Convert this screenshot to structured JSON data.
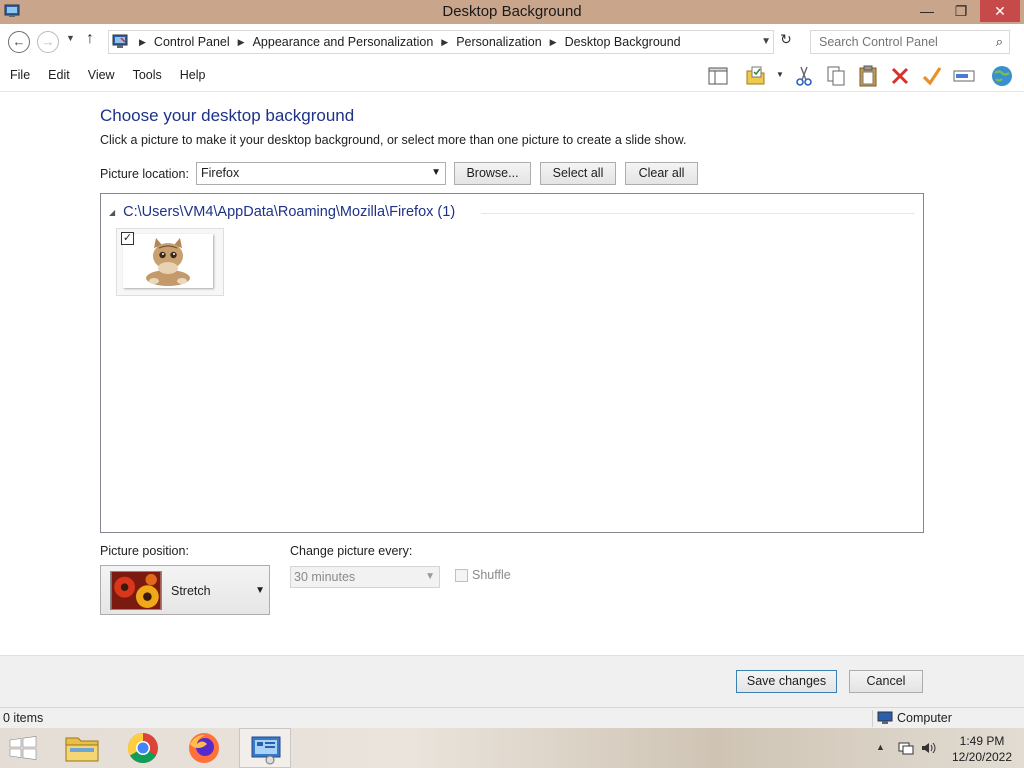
{
  "window": {
    "title": "Desktop Background",
    "min_glyph": "—",
    "max_glyph": "❐",
    "close_glyph": "✕"
  },
  "address": {
    "breadcrumbs": [
      "Control Panel",
      "Appearance and Personalization",
      "Personalization",
      "Desktop Background"
    ],
    "search_placeholder": "Search Control Panel"
  },
  "menu": [
    "File",
    "Edit",
    "View",
    "Tools",
    "Help"
  ],
  "toolbar_icons": [
    "layout-pane-icon",
    "properties-folder-icon",
    "cut-icon",
    "copy-icon",
    "paste-icon",
    "delete-icon",
    "check-icon",
    "rename-icon",
    "globe-icon"
  ],
  "content": {
    "heading": "Choose your desktop background",
    "description": "Click a picture to make it your desktop background, or select more than one picture to create a slide show.",
    "picture_location_label": "Picture location:",
    "picture_location_value": "Firefox",
    "browse_label": "Browse...",
    "select_all_label": "Select all",
    "clear_all_label": "Clear all",
    "group_header": "C:\\Users\\VM4\\AppData\\Roaming\\Mozilla\\Firefox (1)",
    "pictures": [
      {
        "name": "cat-wallpaper",
        "checked": true
      }
    ],
    "picture_position_label": "Picture position:",
    "picture_position_value": "Stretch",
    "change_picture_label": "Change picture every:",
    "change_picture_value": "30 minutes",
    "shuffle_label": "Shuffle",
    "shuffle_checked": false
  },
  "footer": {
    "save_label": "Save changes",
    "cancel_label": "Cancel"
  },
  "statusbar": {
    "items": "0 items",
    "location": "Computer"
  },
  "taskbar": {
    "apps": [
      "file-explorer",
      "chrome",
      "firefox",
      "control-panel"
    ],
    "active_app": "control-panel",
    "time": "1:49 PM",
    "date": "12/20/2022"
  },
  "colors": {
    "titlebar": "#c9a58b",
    "close_button": "#c74a4a",
    "heading": "#1e3287",
    "accent_button_border": "#3c7fb1"
  }
}
